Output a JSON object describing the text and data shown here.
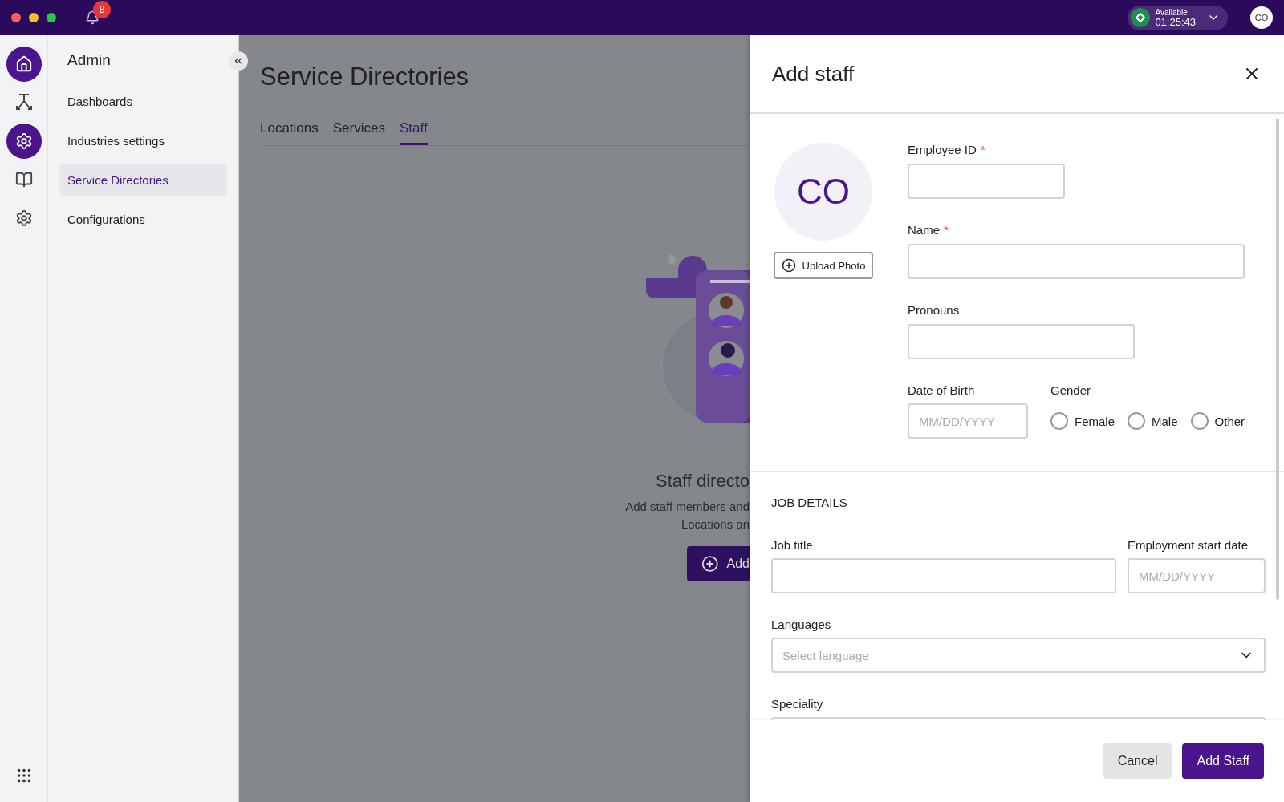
{
  "topbar": {
    "notifications": "8",
    "status": {
      "label": "Available",
      "time": "01:25:43",
      "color": "#1e8e4e"
    },
    "avatar": "CO"
  },
  "rail": [
    {
      "kind": "home",
      "selected": true
    },
    {
      "kind": "flow",
      "selected": false
    },
    {
      "kind": "gear",
      "selected": true
    },
    {
      "kind": "book",
      "selected": false
    },
    {
      "kind": "gear",
      "selected": false
    }
  ],
  "sidebar": {
    "title": "Admin",
    "items": [
      {
        "label": "Dashboards",
        "selected": false
      },
      {
        "label": "Industries settings",
        "selected": false
      },
      {
        "label": "Service Directories",
        "selected": true
      },
      {
        "label": "Configurations",
        "selected": false
      }
    ]
  },
  "page": {
    "title": "Service Directories",
    "tabs": [
      {
        "label": "Locations",
        "selected": false
      },
      {
        "label": "Services",
        "selected": false
      },
      {
        "label": "Staff",
        "selected": true
      }
    ],
    "empty": {
      "title": "Staff directo",
      "lines": [
        "Add staff members and",
        "Locations an"
      ],
      "button": "Add"
    }
  },
  "drawer": {
    "title": "Add staff",
    "avatar": "CO",
    "upload": "Upload Photo",
    "fields": [
      {
        "label": "Employee ID",
        "required_mark": "*"
      },
      {
        "label": "Name",
        "required_mark": "*"
      },
      {
        "label": "Pronouns"
      }
    ],
    "dob": {
      "label": "Date of Birth",
      "placeholder": "MM/DD/YYYY"
    },
    "gender": {
      "label": "Gender",
      "options": [
        {
          "label": "Female",
          "selected": false
        },
        {
          "label": "Male",
          "selected": false
        },
        {
          "label": "Other",
          "selected": false
        }
      ]
    },
    "section": "JOB DETAILS",
    "job_title": {
      "label": "Job title"
    },
    "start_date": {
      "label": "Employment start date",
      "placeholder": "MM/DD/YYYY"
    },
    "languages": {
      "label": "Languages",
      "placeholder": "Select language"
    },
    "speciality": {
      "label": "Speciality"
    },
    "buttons": {
      "cancel": "Cancel",
      "submit": "Add Staff"
    }
  }
}
